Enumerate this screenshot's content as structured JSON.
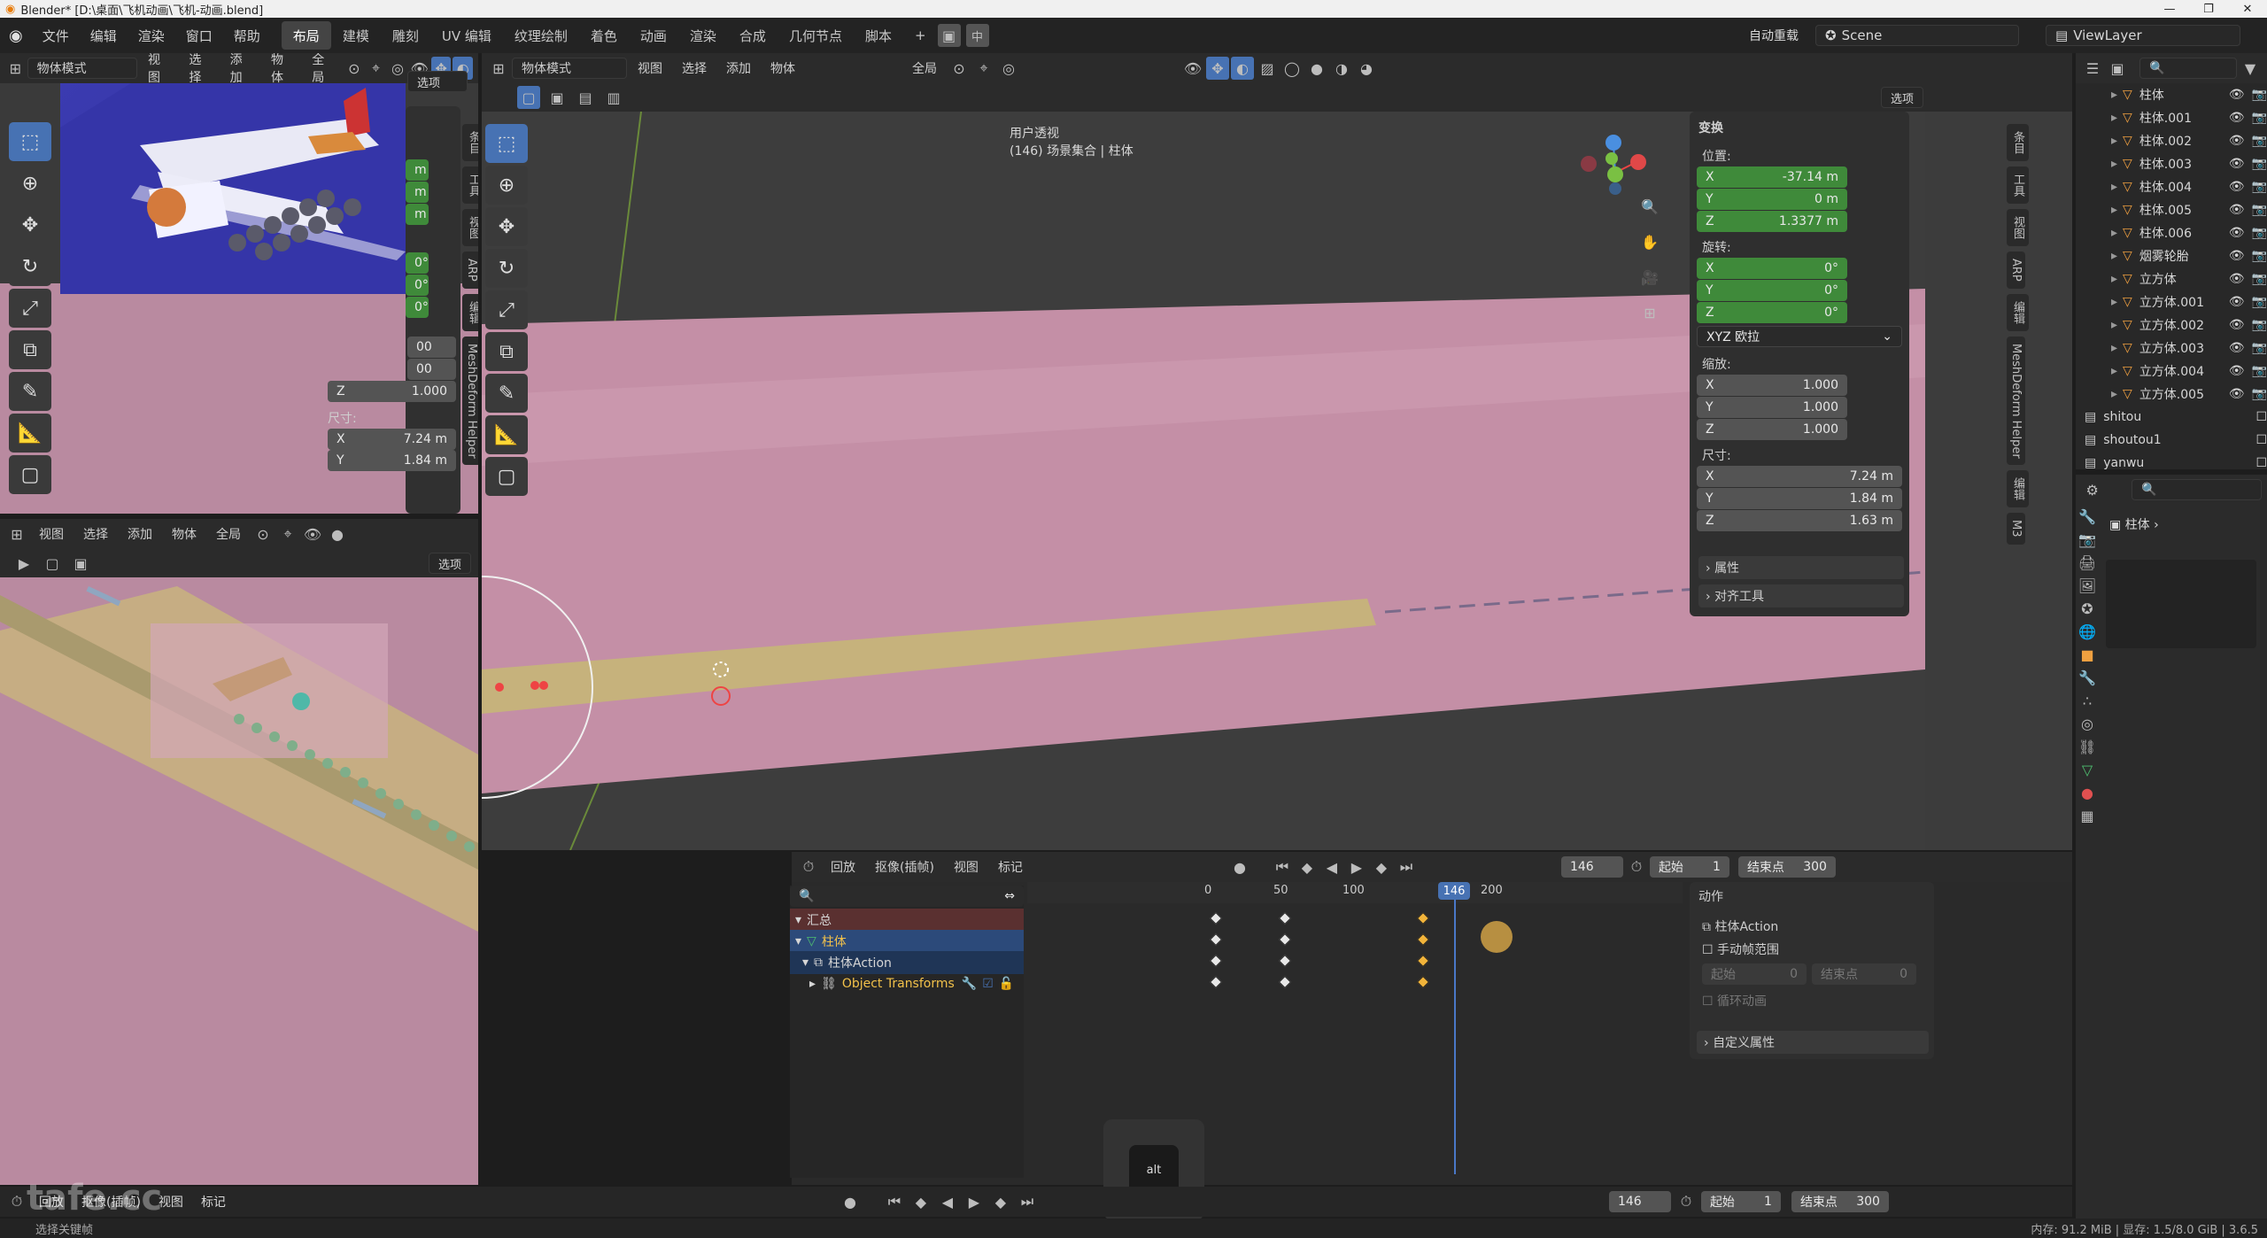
{
  "window": {
    "title": "Blender* [D:\\桌面\\飞机动画\\飞机-动画.blend]"
  },
  "menu": [
    "文件",
    "编辑",
    "渲染",
    "窗口",
    "帮助"
  ],
  "workspaces": [
    "布局",
    "建模",
    "雕刻",
    "UV 编辑",
    "纹理绘制",
    "着色",
    "动画",
    "渲染",
    "合成",
    "几何节点",
    "脚本"
  ],
  "topright": {
    "reload": "自动重载",
    "scene": "Scene",
    "viewlayer": "ViewLayer",
    "lang_a": "中"
  },
  "viewport_header": {
    "mode": "物体模式",
    "items": [
      "视图",
      "选择",
      "添加",
      "物体"
    ],
    "transform": "全局",
    "options": "选项"
  },
  "main_viewport": {
    "view_name": "用户透视",
    "collection": "(146) 场景集合 | 柱体"
  },
  "npanel": {
    "transform_title": "变换",
    "location_label": "位置:",
    "location": [
      {
        "axis": "X",
        "value": "-37.14 m"
      },
      {
        "axis": "Y",
        "value": "0 m"
      },
      {
        "axis": "Z",
        "value": "1.3377 m"
      }
    ],
    "rotation_label": "旋转:",
    "rotation": [
      {
        "axis": "X",
        "value": "0°"
      },
      {
        "axis": "Y",
        "value": "0°"
      },
      {
        "axis": "Z",
        "value": "0°"
      }
    ],
    "rotation_mode": "XYZ 欧拉",
    "scale_label": "缩放:",
    "scale": [
      {
        "axis": "X",
        "value": "1.000"
      },
      {
        "axis": "Y",
        "value": "1.000"
      },
      {
        "axis": "Z",
        "value": "1.000"
      }
    ],
    "dimensions_label": "尺寸:",
    "dimensions": [
      {
        "axis": "X",
        "value": "7.24 m"
      },
      {
        "axis": "Y",
        "value": "1.84 m"
      },
      {
        "axis": "Z",
        "value": "1.63 m"
      }
    ],
    "properties": "属性",
    "align_tools": "对齐工具",
    "tabs": [
      "条目",
      "工具",
      "视图",
      "ARP",
      "编辑",
      "MeshDeform Helper",
      "编辑",
      "M3"
    ]
  },
  "left_npanel": {
    "values_m": [
      "m",
      "m",
      "m"
    ],
    "values_deg": [
      "0°",
      "0°",
      "0°"
    ],
    "values_scale": [
      "00",
      "00"
    ],
    "scale_z": "1.000",
    "dim_label": "尺寸:",
    "dim_x": "7.24 m",
    "dim_y": "1.84 m"
  },
  "outliner": {
    "items": [
      {
        "name": "柱体"
      },
      {
        "name": "柱体.001"
      },
      {
        "name": "柱体.002"
      },
      {
        "name": "柱体.003"
      },
      {
        "name": "柱体.004"
      },
      {
        "name": "柱体.005"
      },
      {
        "name": "柱体.006"
      },
      {
        "name": "烟雾轮胎"
      },
      {
        "name": "立方体"
      },
      {
        "name": "立方体.001"
      },
      {
        "name": "立方体.002"
      },
      {
        "name": "立方体.003"
      },
      {
        "name": "立方体.004"
      },
      {
        "name": "立方体.005"
      }
    ],
    "collections": [
      {
        "name": "shitou"
      },
      {
        "name": "shoutou1"
      },
      {
        "name": "yanwu"
      }
    ]
  },
  "properties_panel": {
    "object": "柱体"
  },
  "timeline": {
    "header": [
      "回放",
      "抠像(插帧)",
      "视图",
      "标记"
    ],
    "current_frame": "146",
    "start_label": "起始",
    "start": "1",
    "end_label": "结束点",
    "end": "300",
    "ticks": [
      "0",
      "50",
      "100",
      "146",
      "200"
    ],
    "channels": [
      {
        "name": "汇总"
      },
      {
        "name": "柱体"
      },
      {
        "name": "柱体Action"
      },
      {
        "name": "Object Transforms"
      }
    ],
    "action_panel": {
      "title": "动作",
      "action": "柱体Action",
      "manual_range": "手动帧范围",
      "start": "起始",
      "start_val": "0",
      "end": "结束点",
      "end_val": "0",
      "cycle": "循环动画",
      "custom": "自定义属性"
    }
  },
  "bottom_timeline": {
    "header": [
      "回放",
      "抠像(插帧)",
      "视图",
      "标记"
    ],
    "frame": "146",
    "start_label": "起始",
    "start": "1",
    "end_label": "结束点",
    "end": "300"
  },
  "key_overlay": {
    "label": "alt"
  },
  "status": {
    "left": "选择关键帧",
    "right": "内存: 91.2 MiB | 显存: 1.5/8.0 GiB | 3.6.5"
  },
  "watermark": "tafe.cc",
  "colors": {
    "accent": "#4772b3",
    "keyframe_sel": "#f2b43a",
    "green_field": "#3f8a3a",
    "ground": "#c78fa8"
  }
}
